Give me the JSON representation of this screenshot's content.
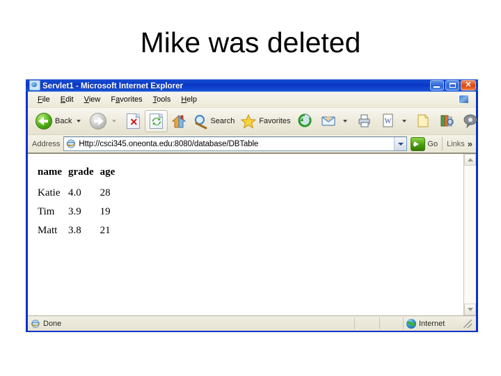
{
  "slide": {
    "title": "Mike was deleted"
  },
  "browser": {
    "window_title": "Servlet1 - Microsoft Internet Explorer",
    "window_icon": "ie-document-icon",
    "controls": {
      "minimize": "minimize-button",
      "maximize": "maximize-button",
      "close": "close-button"
    },
    "menu": [
      {
        "label": "File",
        "accel": "F"
      },
      {
        "label": "Edit",
        "accel": "E"
      },
      {
        "label": "View",
        "accel": "V"
      },
      {
        "label": "Favorites",
        "accel": "a"
      },
      {
        "label": "Tools",
        "accel": "T"
      },
      {
        "label": "Help",
        "accel": "H"
      }
    ],
    "toolbar": {
      "back_label": "Back",
      "search_label": "Search",
      "favorites_label": "Favorites",
      "icons": [
        "back-icon",
        "forward-icon",
        "stop-icon",
        "refresh-icon",
        "home-icon",
        "search-icon",
        "favorites-star-icon",
        "history-icon",
        "mail-icon",
        "print-icon",
        "edit-word-icon",
        "folder-icon",
        "research-icon",
        "discuss-icon",
        "messenger-icon"
      ]
    },
    "address": {
      "label": "Address",
      "url": "Http://csci345.oneonta.edu:8080/database/DBTable",
      "go_label": "Go",
      "links_label": "Links",
      "overflow_chevron": "»"
    },
    "status": {
      "message": "Done",
      "zone": "Internet"
    }
  },
  "page_content": {
    "table": {
      "headers": [
        "name",
        "grade",
        "age"
      ],
      "rows": [
        [
          "Katie",
          "4.0",
          "28"
        ],
        [
          "Tim",
          "3.9",
          "19"
        ],
        [
          "Matt",
          "3.8",
          "21"
        ]
      ]
    }
  },
  "colors": {
    "titlebar_blue": "#0a31c8",
    "chrome_beige": "#ece9d8",
    "page_white": "#ffffff",
    "close_red": "#d9440f",
    "go_green": "#4a9e10"
  }
}
